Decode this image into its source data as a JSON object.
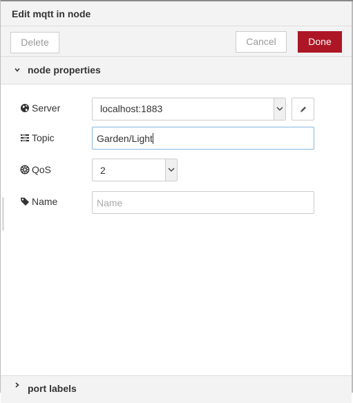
{
  "tray": {
    "title": "Edit mqtt in node"
  },
  "toolbar": {
    "delete_label": "Delete",
    "cancel_label": "Cancel",
    "done_label": "Done",
    "done_color": "#ad1625"
  },
  "sections": {
    "node_properties": "node properties",
    "port_labels": "port labels"
  },
  "form": {
    "server": {
      "label": "Server",
      "icon": "globe-icon",
      "value": "localhost:1883"
    },
    "topic": {
      "label": "Topic",
      "icon": "tasks-icon",
      "value": "Garden/Light"
    },
    "qos": {
      "label": "QoS",
      "icon": "life-ring-icon",
      "value": "2"
    },
    "name": {
      "label": "Name",
      "icon": "tag-icon",
      "value": "",
      "placeholder": "Name"
    }
  }
}
